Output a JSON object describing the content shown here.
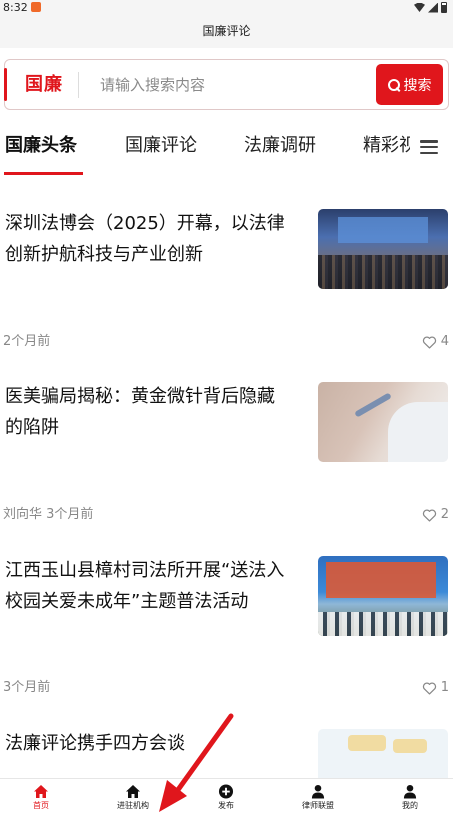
{
  "status_bar": {
    "time": "8:32"
  },
  "header": {
    "title": "国廉评论"
  },
  "search": {
    "logo": "国廉",
    "placeholder": "请输入搜索内容",
    "button_label": "搜索"
  },
  "tabs": [
    "国廉头条",
    "国廉评论",
    "法廉调研",
    "精彩视"
  ],
  "news": [
    {
      "title": "深圳法博会（2025）开幕，以法律创新护航科技与产业创新",
      "meta": "2个月前",
      "likes": "4"
    },
    {
      "title": "医美骗局揭秘：黄金微针背后隐藏的陷阱",
      "meta": "刘向华 3个月前",
      "likes": "2"
    },
    {
      "title": "江西玉山县樟村司法所开展“送法入校园关爱未成年”主题普法活动",
      "meta": "3个月前",
      "likes": "1"
    },
    {
      "title": "法廉评论携手四方会谈",
      "meta": "",
      "likes": ""
    }
  ],
  "bottom_nav": [
    {
      "label": "首页",
      "icon": "home-icon"
    },
    {
      "label": "进驻机构",
      "icon": "home-icon"
    },
    {
      "label": "发布",
      "icon": "plus-circle-icon"
    },
    {
      "label": "律师联盟",
      "icon": "user-icon"
    },
    {
      "label": "我的",
      "icon": "user-icon"
    }
  ],
  "colors": {
    "accent": "#e0161c",
    "meta_text": "#888888"
  }
}
